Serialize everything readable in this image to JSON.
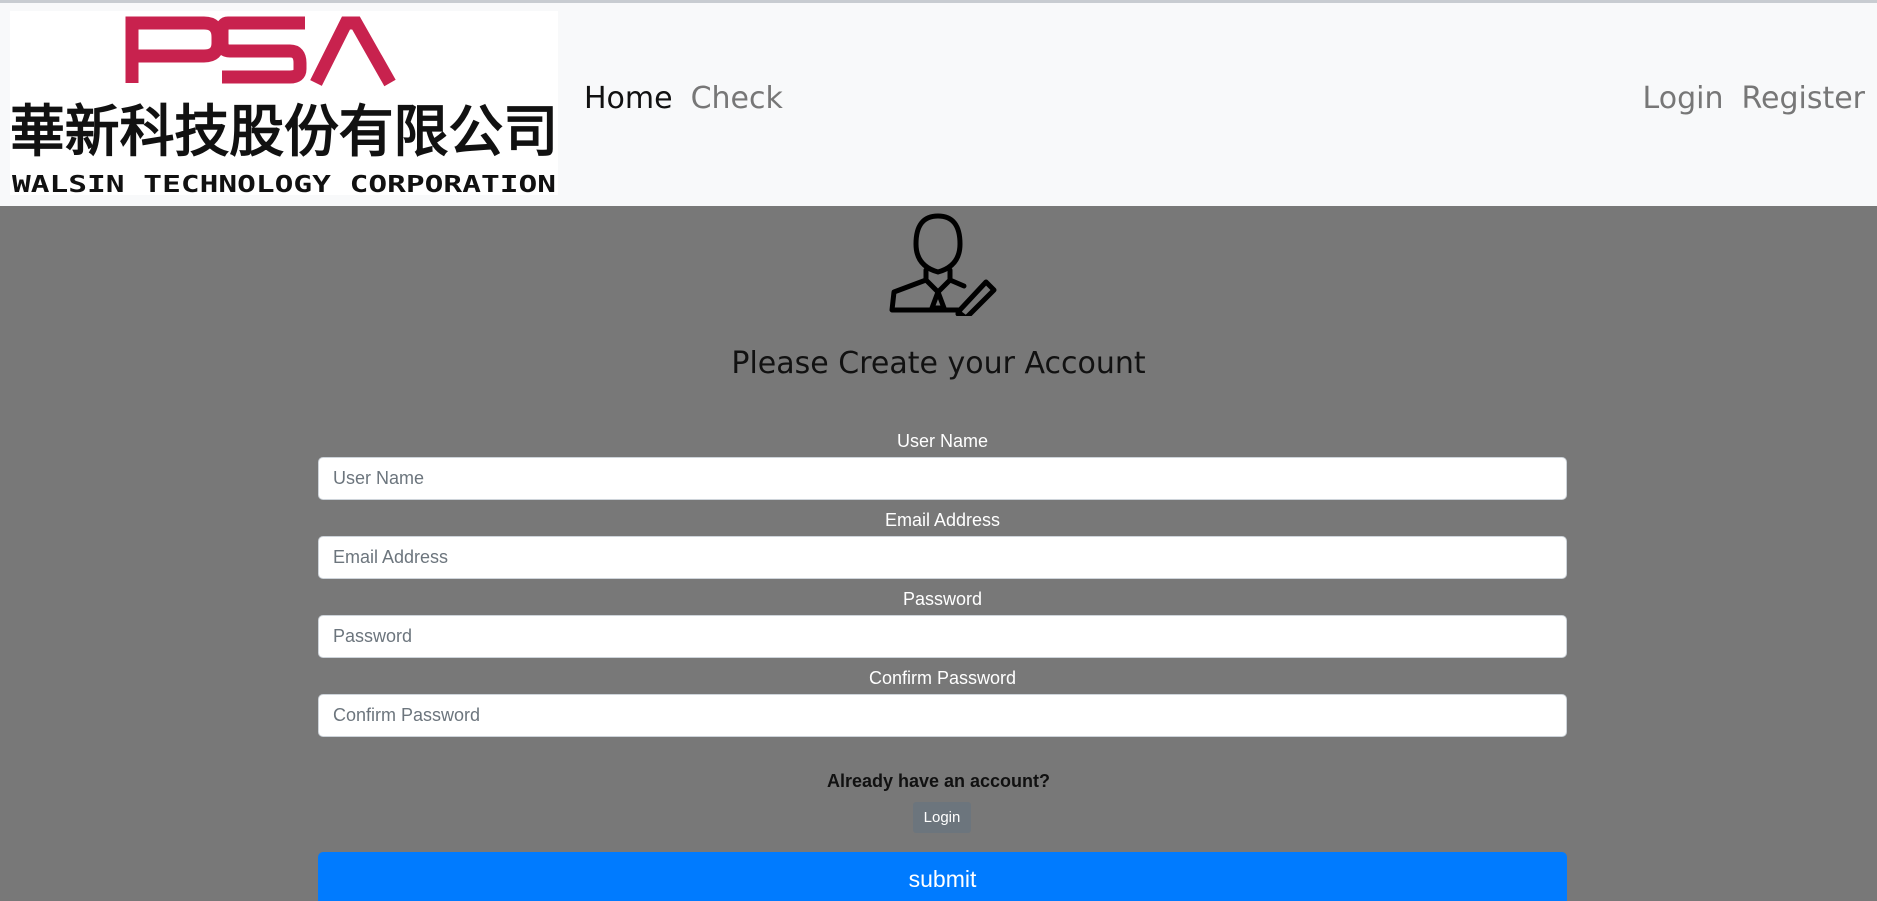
{
  "brand": {
    "logo_top": "PSA",
    "logo_chinese": "華新科技股份有限公司",
    "logo_english": "WALSIN TECHNOLOGY CORPORATION",
    "logo_accent_color": "#c8224e"
  },
  "nav": {
    "left": [
      {
        "label": "Home",
        "active": true
      },
      {
        "label": "Check",
        "active": false
      }
    ],
    "right": [
      {
        "label": "Login"
      },
      {
        "label": "Register"
      }
    ]
  },
  "page": {
    "icon": "user-edit-icon",
    "heading": "Please Create your Account"
  },
  "form": {
    "fields": [
      {
        "label": "User Name",
        "placeholder": "User Name"
      },
      {
        "label": "Email Address",
        "placeholder": "Email Address"
      },
      {
        "label": "Password",
        "placeholder": "Password"
      },
      {
        "label": "Confirm Password",
        "placeholder": "Confirm Password"
      }
    ],
    "already_text": "Already have an account?",
    "login_button": "Login",
    "submit_button": "submit"
  },
  "colors": {
    "navbar_bg": "#f8f9fa",
    "page_bg": "#787878",
    "submit_bg": "#007bff",
    "login_btn_bg": "#6c757d"
  }
}
